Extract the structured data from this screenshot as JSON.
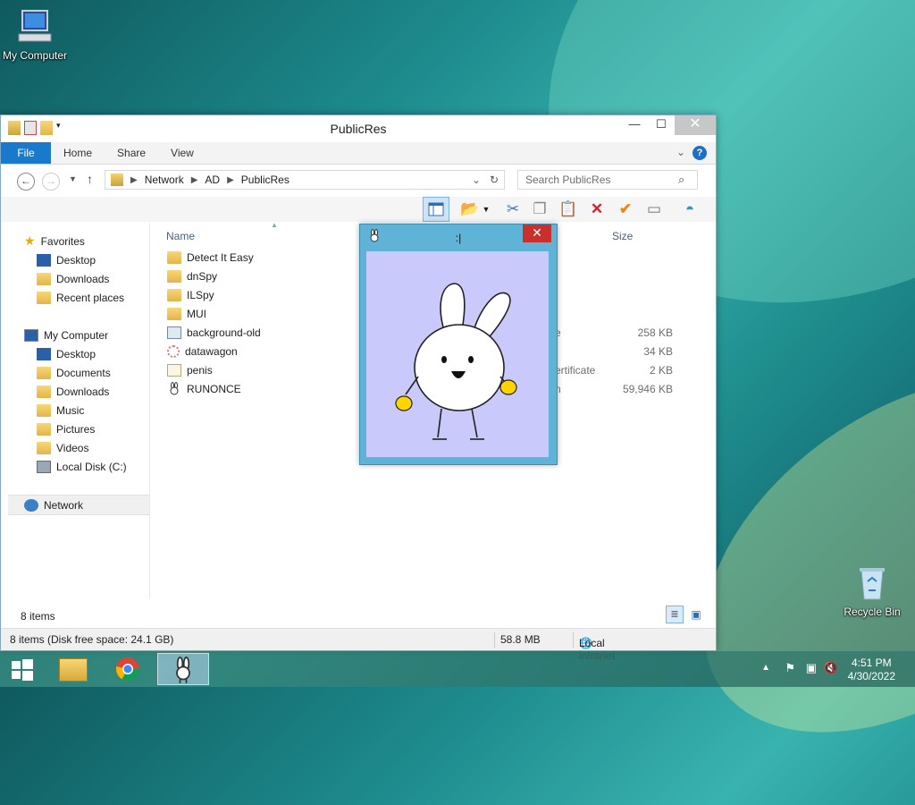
{
  "desktop": {
    "icons": [
      {
        "label": "My Computer",
        "icon": "computer-icon"
      },
      {
        "label": "Recycle Bin",
        "icon": "recycle-bin-icon"
      }
    ]
  },
  "explorer": {
    "title": "PublicRes",
    "ribbon_tabs": [
      "File",
      "Home",
      "Share",
      "View"
    ],
    "breadcrumb": [
      "Network",
      "AD",
      "PublicRes"
    ],
    "search_placeholder": "Search PublicRes",
    "nav": {
      "favorites": {
        "label": "Favorites",
        "items": [
          "Desktop",
          "Downloads",
          "Recent places"
        ]
      },
      "computer": {
        "label": "My Computer",
        "items": [
          "Desktop",
          "Documents",
          "Downloads",
          "Music",
          "Pictures",
          "Videos",
          "Local Disk (C:)"
        ]
      },
      "network": {
        "label": "Network"
      }
    },
    "columns": {
      "name": "Name",
      "size": "Size"
    },
    "files": [
      {
        "name": "Detect It Easy",
        "icon": "folder-icon",
        "type": "",
        "size": ""
      },
      {
        "name": "dnSpy",
        "icon": "folder-icon",
        "type": "",
        "size": ""
      },
      {
        "name": "ILSpy",
        "icon": "folder-icon",
        "type": "",
        "size": ""
      },
      {
        "name": "MUI",
        "icon": "folder-icon",
        "type": "",
        "size": ""
      },
      {
        "name": "background-old",
        "icon": "image-file-icon",
        "type": "e",
        "size": "258 KB"
      },
      {
        "name": "datawagon",
        "icon": "gear-file-icon",
        "type": "",
        "size": "34 KB"
      },
      {
        "name": "penis",
        "icon": "certificate-icon",
        "type": "ertificate",
        "size": "2 KB"
      },
      {
        "name": "RUNONCE",
        "icon": "bunny-app-icon",
        "type": "n",
        "size": "59,946 KB"
      }
    ],
    "item_count": "8 items",
    "details": {
      "summary": "8 items (Disk free space: 24.1 GB)",
      "size": "58.8 MB",
      "zone": "Local intranet"
    }
  },
  "popup": {
    "title": ":|",
    "close": "✕"
  },
  "taskbar": {
    "items": [
      "start-icon",
      "file-explorer-icon",
      "chrome-icon",
      "bunny-app-icon"
    ],
    "time": "4:51 PM",
    "date": "4/30/2022"
  }
}
